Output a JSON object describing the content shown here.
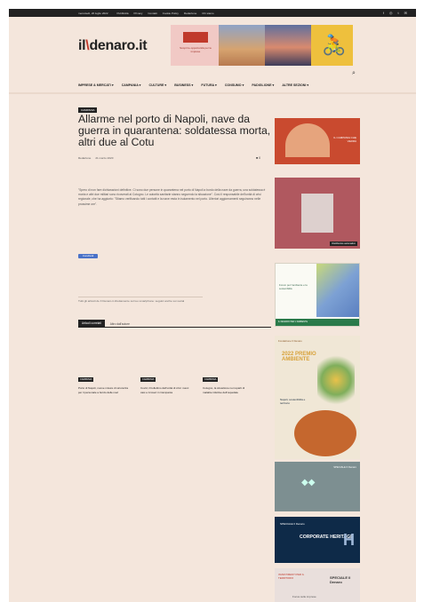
{
  "topbar": {
    "date": "mercoledì, 20 luglio 2022",
    "links": [
      "Pubblicità",
      "Privacy",
      "Contatti",
      "Cookie Policy",
      "Redazione",
      "Chi siamo"
    ],
    "socials": [
      "f",
      "◎",
      "t",
      "✉"
    ]
  },
  "logo": {
    "part1": "il",
    "dot": "\\",
    "part2": "denaro.it"
  },
  "banner1": {
    "text": "Scopri le opportunità per le imprese"
  },
  "nav": {
    "items": [
      "IMPRESE & MERCATI ▾",
      "CAMPANIA ▾",
      "CULTURE ▾",
      "BUSINESS ▾",
      "FUTURA ▾",
      "CONSUMO ▾",
      "PADIGLIONE ▾",
      "ALTRE SEZIONI ▾"
    ]
  },
  "article": {
    "section": "CAMPANIA",
    "title": "Allarme nel porto di Napoli, nave da guerra in quarantena: soldatessa morta, altri due al Cotu",
    "author": "Redazione",
    "date": "21 marzo 2020",
    "comments": "0",
    "body": "\"Spero di non fare dichiarazioni definitive. Ci sono due persone in quarantena nel porto di Napoli a bordo della nave da guerra, una soldatessa è morta e altri due militari sono ricoverati al Cotugno. Le autorità sanitarie stanno seguendo la situazione\". Così il responsabile dell'unità di crisi regionale, che ha aggiunto: \"Stiamo verificando tutti i contatti e la nave resta in isolamento nel porto. Ulteriori aggiornamenti seguiranno nelle prossime ore\".",
    "share_button": "Condividi",
    "caption": "Tutti gli articoli de Il Denaro.it direttamente sul tuo smartphone: seguici anche sui social"
  },
  "tabs": {
    "active": "Articoli correlati",
    "inactive": "Altro dall'autore"
  },
  "related": [
    {
      "category": "CAMPANIA",
      "title": "Porto di Napoli, nuove misure di sicurezza per il personale a bordo delle navi"
    },
    {
      "category": "CAMPANIA",
      "title": "Covid, il bollettino dell'unità di crisi: nuovi casi e ricoveri in Campania"
    },
    {
      "category": "CAMPANIA",
      "title": "Cotugno, la situazione nei reparti di malattie infettive dell'ospedale"
    }
  ],
  "ads": {
    "ad1": "IL CAMPANIA CHE VERRÀ",
    "ad2": "Distributore automatico",
    "ad3_text": "Forum per l'ambiente e la sostenibilità",
    "ad3_bar": "IL DENARO PER L'AMBIENTE",
    "ad4_logo": "Fondazione Il Denaro",
    "ad4_headline": "2022 PREMIO AMBIENTE",
    "ad4_sub": "Napoli, sostenibilità e territorio",
    "ad5": "SPECIALE Il Denaro",
    "ad6_t1": "SPECIALE Il Denaro",
    "ad6_t2": "CORPORATE HERITAGE",
    "ad6_h": "H",
    "ad7_t1": "INVESTIMENTI PER IL TERRITORIO",
    "ad7_t2": "SPECIALE Il Denaro",
    "ad7_t3": "Focus sulle imprese"
  }
}
